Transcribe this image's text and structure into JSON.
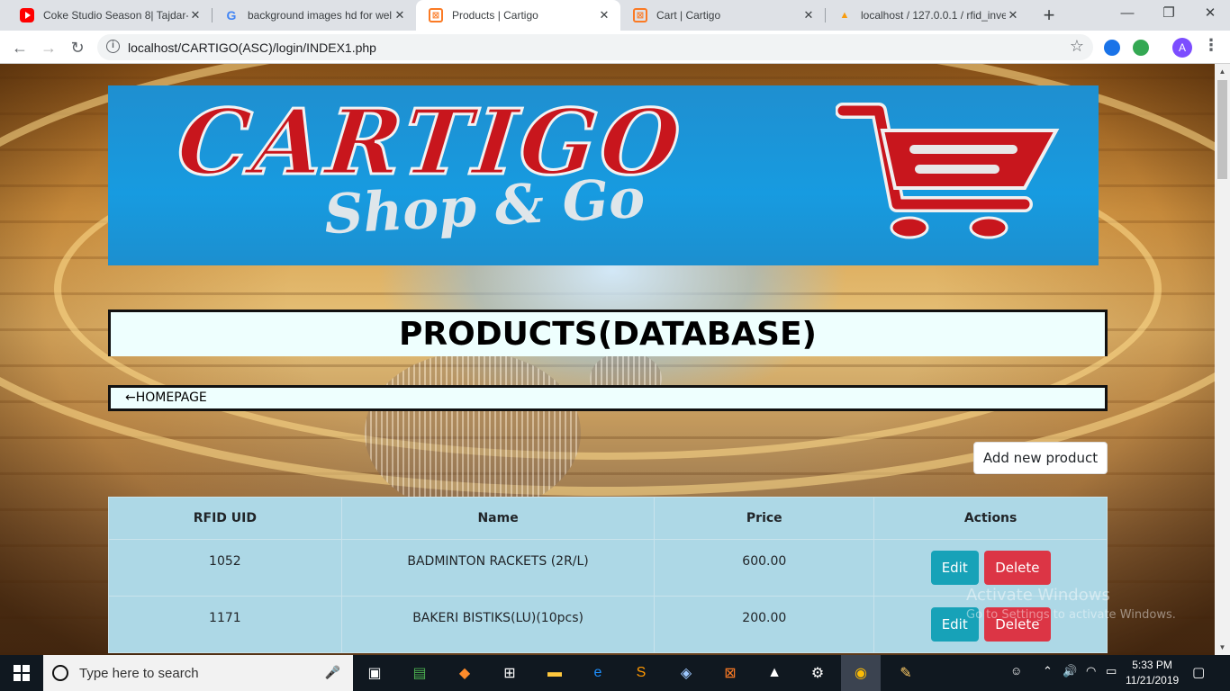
{
  "browser": {
    "tabs": [
      {
        "title": "Coke Studio Season 8| Tajdar-e",
        "icon": "youtube-icon"
      },
      {
        "title": "background images hd for wel",
        "icon": "google-icon"
      },
      {
        "title": "Products | Cartigo",
        "icon": "xampp-icon",
        "active": true
      },
      {
        "title": "Cart | Cartigo",
        "icon": "xampp-icon"
      },
      {
        "title": "localhost / 127.0.0.1 / rfid_inve",
        "icon": "phpmyadmin-icon"
      }
    ],
    "url": "localhost/CARTIGO(ASC)/login/INDEX1.php",
    "profile_initial": "A"
  },
  "page": {
    "logo_main": "CARTIGO",
    "logo_sub": "Shop & Go",
    "title": "PRODUCTS(DATABASE)",
    "homepage_link": "←HOMEPAGE",
    "add_button": "Add new product"
  },
  "table": {
    "headers": [
      "RFID UID",
      "Name",
      "Price",
      "Actions"
    ],
    "rows": [
      {
        "uid": "1052",
        "name": "BADMINTON RACKETS (2R/L)",
        "price": "600.00"
      },
      {
        "uid": "1171",
        "name": "BAKERI BISTIKS(LU)(10pcs)",
        "price": "200.00"
      }
    ],
    "edit_label": "Edit",
    "delete_label": "Delete"
  },
  "watermark": {
    "line1": "Activate Windows",
    "line2": "Go to Settings to activate Windows."
  },
  "taskbar": {
    "search_placeholder": "Type here to search",
    "time": "5:33 PM",
    "date": "11/21/2019"
  },
  "colors": {
    "table_bg": "#add8e6",
    "edit": "#17a2b8",
    "delete": "#dc3545",
    "logo_red": "#c8161d",
    "banner_blue": "#179be0"
  }
}
